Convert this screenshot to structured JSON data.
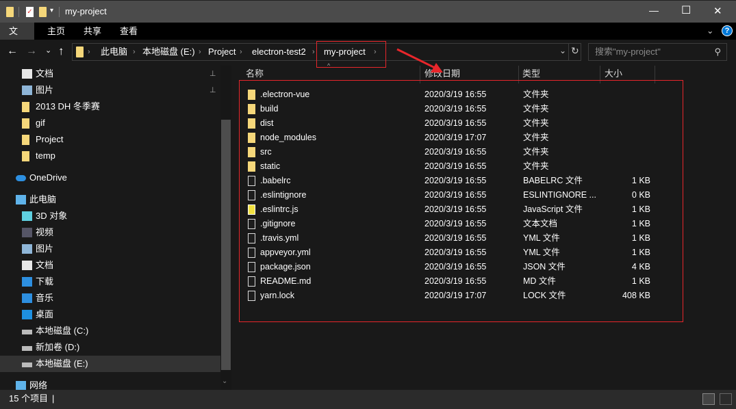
{
  "window": {
    "title": "my-project",
    "minimize": "—",
    "maximize": "☐",
    "close": "✕"
  },
  "ribbon": {
    "tabs": [
      "文件",
      "主页",
      "共享",
      "查看"
    ],
    "help": "?",
    "expand": "⌄"
  },
  "nav": {
    "back": "←",
    "forward": "→",
    "recent": "⌄",
    "up": "↑",
    "refresh": "↻",
    "dropdown": "⌄"
  },
  "breadcrumb": [
    "此电脑",
    "本地磁盘 (E:)",
    "Project",
    "electron-test2",
    "my-project"
  ],
  "search": {
    "placeholder": "搜索\"my-project\""
  },
  "sidebar": {
    "items": [
      {
        "label": "文档",
        "icon": "document-icon",
        "pinned": true
      },
      {
        "label": "图片",
        "icon": "pictures-icon",
        "pinned": true
      },
      {
        "label": "2013 DH 冬季赛",
        "icon": "folder-icon"
      },
      {
        "label": "gif",
        "icon": "folder-icon"
      },
      {
        "label": "Project",
        "icon": "folder-icon"
      },
      {
        "label": "temp",
        "icon": "folder-icon"
      },
      {
        "label": "OneDrive",
        "icon": "cloud-icon"
      },
      {
        "label": "此电脑",
        "icon": "computer-icon"
      },
      {
        "label": "3D 对象",
        "icon": "cube-icon"
      },
      {
        "label": "视频",
        "icon": "video-icon"
      },
      {
        "label": "图片",
        "icon": "pictures-icon"
      },
      {
        "label": "文档",
        "icon": "document-icon"
      },
      {
        "label": "下载",
        "icon": "download-icon"
      },
      {
        "label": "音乐",
        "icon": "music-icon"
      },
      {
        "label": "桌面",
        "icon": "desktop-icon"
      },
      {
        "label": "本地磁盘 (C:)",
        "icon": "drive-icon"
      },
      {
        "label": "新加卷 (D:)",
        "icon": "drive-icon"
      },
      {
        "label": "本地磁盘 (E:)",
        "icon": "drive-icon",
        "selected": true
      },
      {
        "label": "网络",
        "icon": "network-icon"
      }
    ]
  },
  "columns": [
    "名称",
    "修改日期",
    "类型",
    "大小"
  ],
  "files": [
    {
      "name": ".electron-vue",
      "date": "2020/3/19 16:55",
      "type": "文件夹",
      "size": "",
      "kind": "folder"
    },
    {
      "name": "build",
      "date": "2020/3/19 16:55",
      "type": "文件夹",
      "size": "",
      "kind": "folder"
    },
    {
      "name": "dist",
      "date": "2020/3/19 16:55",
      "type": "文件夹",
      "size": "",
      "kind": "folder"
    },
    {
      "name": "node_modules",
      "date": "2020/3/19 17:07",
      "type": "文件夹",
      "size": "",
      "kind": "folder"
    },
    {
      "name": "src",
      "date": "2020/3/19 16:55",
      "type": "文件夹",
      "size": "",
      "kind": "folder"
    },
    {
      "name": "static",
      "date": "2020/3/19 16:55",
      "type": "文件夹",
      "size": "",
      "kind": "folder"
    },
    {
      "name": ".babelrc",
      "date": "2020/3/19 16:55",
      "type": "BABELRC 文件",
      "size": "1 KB",
      "kind": "file"
    },
    {
      "name": ".eslintignore",
      "date": "2020/3/19 16:55",
      "type": "ESLINTIGNORE ...",
      "size": "0 KB",
      "kind": "file"
    },
    {
      "name": ".eslintrc.js",
      "date": "2020/3/19 16:55",
      "type": "JavaScript 文件",
      "size": "1 KB",
      "kind": "js"
    },
    {
      "name": ".gitignore",
      "date": "2020/3/19 16:55",
      "type": "文本文档",
      "size": "1 KB",
      "kind": "file"
    },
    {
      "name": ".travis.yml",
      "date": "2020/3/19 16:55",
      "type": "YML 文件",
      "size": "1 KB",
      "kind": "file"
    },
    {
      "name": "appveyor.yml",
      "date": "2020/3/19 16:55",
      "type": "YML 文件",
      "size": "1 KB",
      "kind": "file"
    },
    {
      "name": "package.json",
      "date": "2020/3/19 16:55",
      "type": "JSON 文件",
      "size": "4 KB",
      "kind": "file"
    },
    {
      "name": "README.md",
      "date": "2020/3/19 16:55",
      "type": "MD 文件",
      "size": "1 KB",
      "kind": "file"
    },
    {
      "name": "yarn.lock",
      "date": "2020/3/19 17:07",
      "type": "LOCK 文件",
      "size": "408 KB",
      "kind": "file"
    }
  ],
  "status": {
    "count": "15 个项目"
  },
  "colors": {
    "annotation": "#e8262b",
    "folder": "#f5d77a",
    "accent": "#0078d7"
  }
}
